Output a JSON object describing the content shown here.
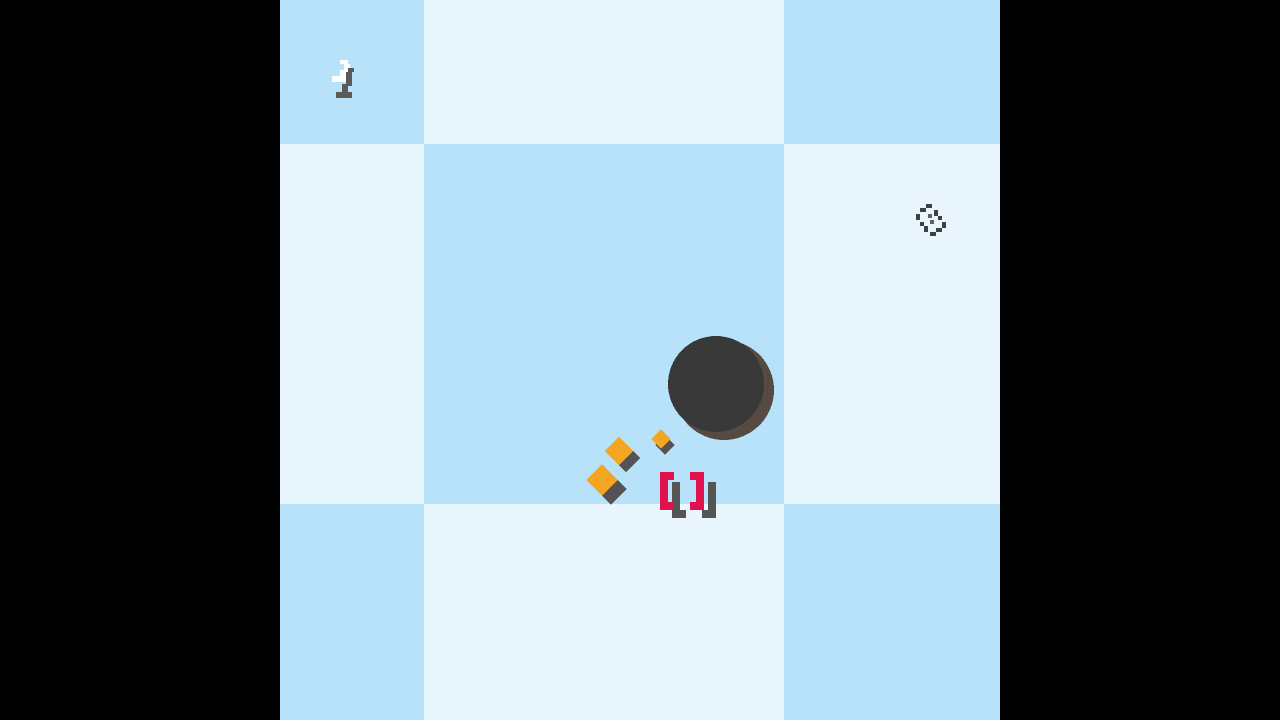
{
  "game": {
    "palette": {
      "tile_light": "#eaf6fe",
      "tile_blue": "#b8e2f9",
      "letterbox": "#000000",
      "boulder": "#383838",
      "boulder_shadow": "#574a42",
      "pellet": "#f4a623",
      "pellet_shadow": "#535353",
      "player": "#e0124d",
      "player_shadow": "#555555",
      "pickup_outline": "#404040"
    },
    "board": {
      "pattern": "checkerboard",
      "tiles": [
        [
          "tile_blue",
          "tile_light",
          "tile_blue"
        ],
        [
          "tile_light",
          "tile_blue",
          "tile_light"
        ],
        [
          "tile_blue",
          "tile_light",
          "tile_blue"
        ]
      ]
    },
    "entities": {
      "exit_icon": "exit-door-icon",
      "pickup_icon": "diamond-outline-icon",
      "boulder_icon": "boulder-icon",
      "pellet_icon": "pellet-icon",
      "player_icon": "bracket-player-icon",
      "pellet_count": 3
    }
  }
}
